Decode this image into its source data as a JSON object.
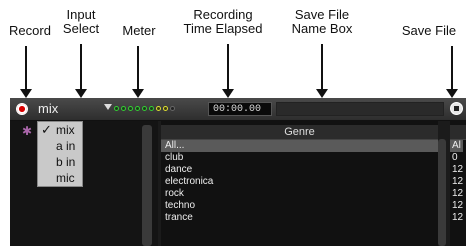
{
  "annotations": {
    "record": "Record",
    "input_select": "Input\nSelect",
    "meter": "Meter",
    "time": "Recording\nTime Elapsed",
    "name_box": "Save File\nName Box",
    "save_file": "Save File"
  },
  "toolbar": {
    "input_value": "mix",
    "time_elapsed": "00:00.00"
  },
  "input_menu": {
    "items": [
      "mix",
      "a in",
      "b in",
      "mic"
    ],
    "checked_mark": "✓"
  },
  "genre": {
    "header": "Genre",
    "items": [
      "All...",
      "club",
      "dance",
      "electronica",
      "rock",
      "techno",
      "trance"
    ]
  },
  "right_column": {
    "items": [
      "Al",
      "0",
      "12",
      "12",
      "12",
      "12",
      "12"
    ]
  },
  "colors": {
    "record": "#e31b1b",
    "meter_green": "#33cc33",
    "meter_yellow": "#dddd33"
  },
  "icons": {
    "record": "record-icon",
    "dropdown": "chevron-down-icon",
    "save": "save-icon",
    "star": "star-icon"
  }
}
